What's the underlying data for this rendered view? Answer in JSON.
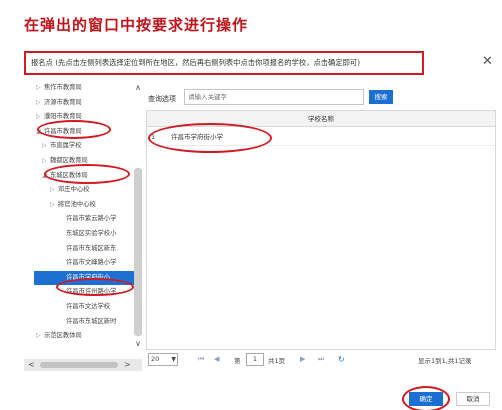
{
  "instruction": "在弹出的窗口中按要求进行操作",
  "dialog": {
    "title": "报名点 (先点击左侧列表选择定位到所在地区，然后再右侧列表中点击你项报名的学校，点击确定即可)",
    "close_icon": "close-icon"
  },
  "tree": [
    {
      "label": "焦作市教育局",
      "arrow": "▷",
      "expanded": false
    },
    {
      "label": "济源市教育局",
      "arrow": "▷",
      "expanded": false
    },
    {
      "label": "濮阳市教育局",
      "arrow": "▷",
      "expanded": false
    },
    {
      "label": "许昌市教育局",
      "arrow": "◢",
      "expanded": true
    },
    {
      "label": "市直属学校",
      "arrow": "▷",
      "expanded": false
    },
    {
      "label": "魏都区教育局",
      "arrow": "▷",
      "expanded": false
    },
    {
      "label": "东城区教体局",
      "arrow": "◢",
      "expanded": true
    },
    {
      "label": "邓庄中心校",
      "arrow": "▷",
      "expanded": false
    },
    {
      "label": "將官池中心校",
      "arrow": "▷",
      "expanded": false
    },
    {
      "label": "许昌市紫云路小学",
      "arrow": "",
      "expanded": false
    },
    {
      "label": "东城区实验学校小",
      "arrow": "",
      "expanded": false
    },
    {
      "label": "许昌市东城区新东",
      "arrow": "",
      "expanded": false
    },
    {
      "label": "许昌市文峰路小学",
      "arrow": "",
      "expanded": false
    },
    {
      "label": "许昌市学府街小",
      "arrow": "",
      "expanded": false,
      "selected": true
    },
    {
      "label": "许昌市许州路小学",
      "arrow": "",
      "expanded": false
    },
    {
      "label": "许昌市文达学校",
      "arrow": "",
      "expanded": false
    },
    {
      "label": "许昌市东城区新时",
      "arrow": "",
      "expanded": false
    },
    {
      "label": "示范区教体局",
      "arrow": "▷",
      "expanded": false
    }
  ],
  "search": {
    "label": "查询选项",
    "placeholder": "请输入关键字",
    "button_label": "搜索"
  },
  "grid": {
    "column_header": "学校名称",
    "rows": [
      {
        "num": "1",
        "name": "许昌市学府街小学"
      }
    ]
  },
  "pager": {
    "page_size": "20",
    "page_label_before": "第",
    "current_page": "1",
    "page_label_after": "共1页",
    "info": "显示1到1,共1记录"
  },
  "footer": {
    "confirm_label": "确定",
    "cancel_label": "取消"
  },
  "colors": {
    "accent": "#1a6fd1",
    "annotation": "#d21a22",
    "heading": "#c0141b"
  }
}
